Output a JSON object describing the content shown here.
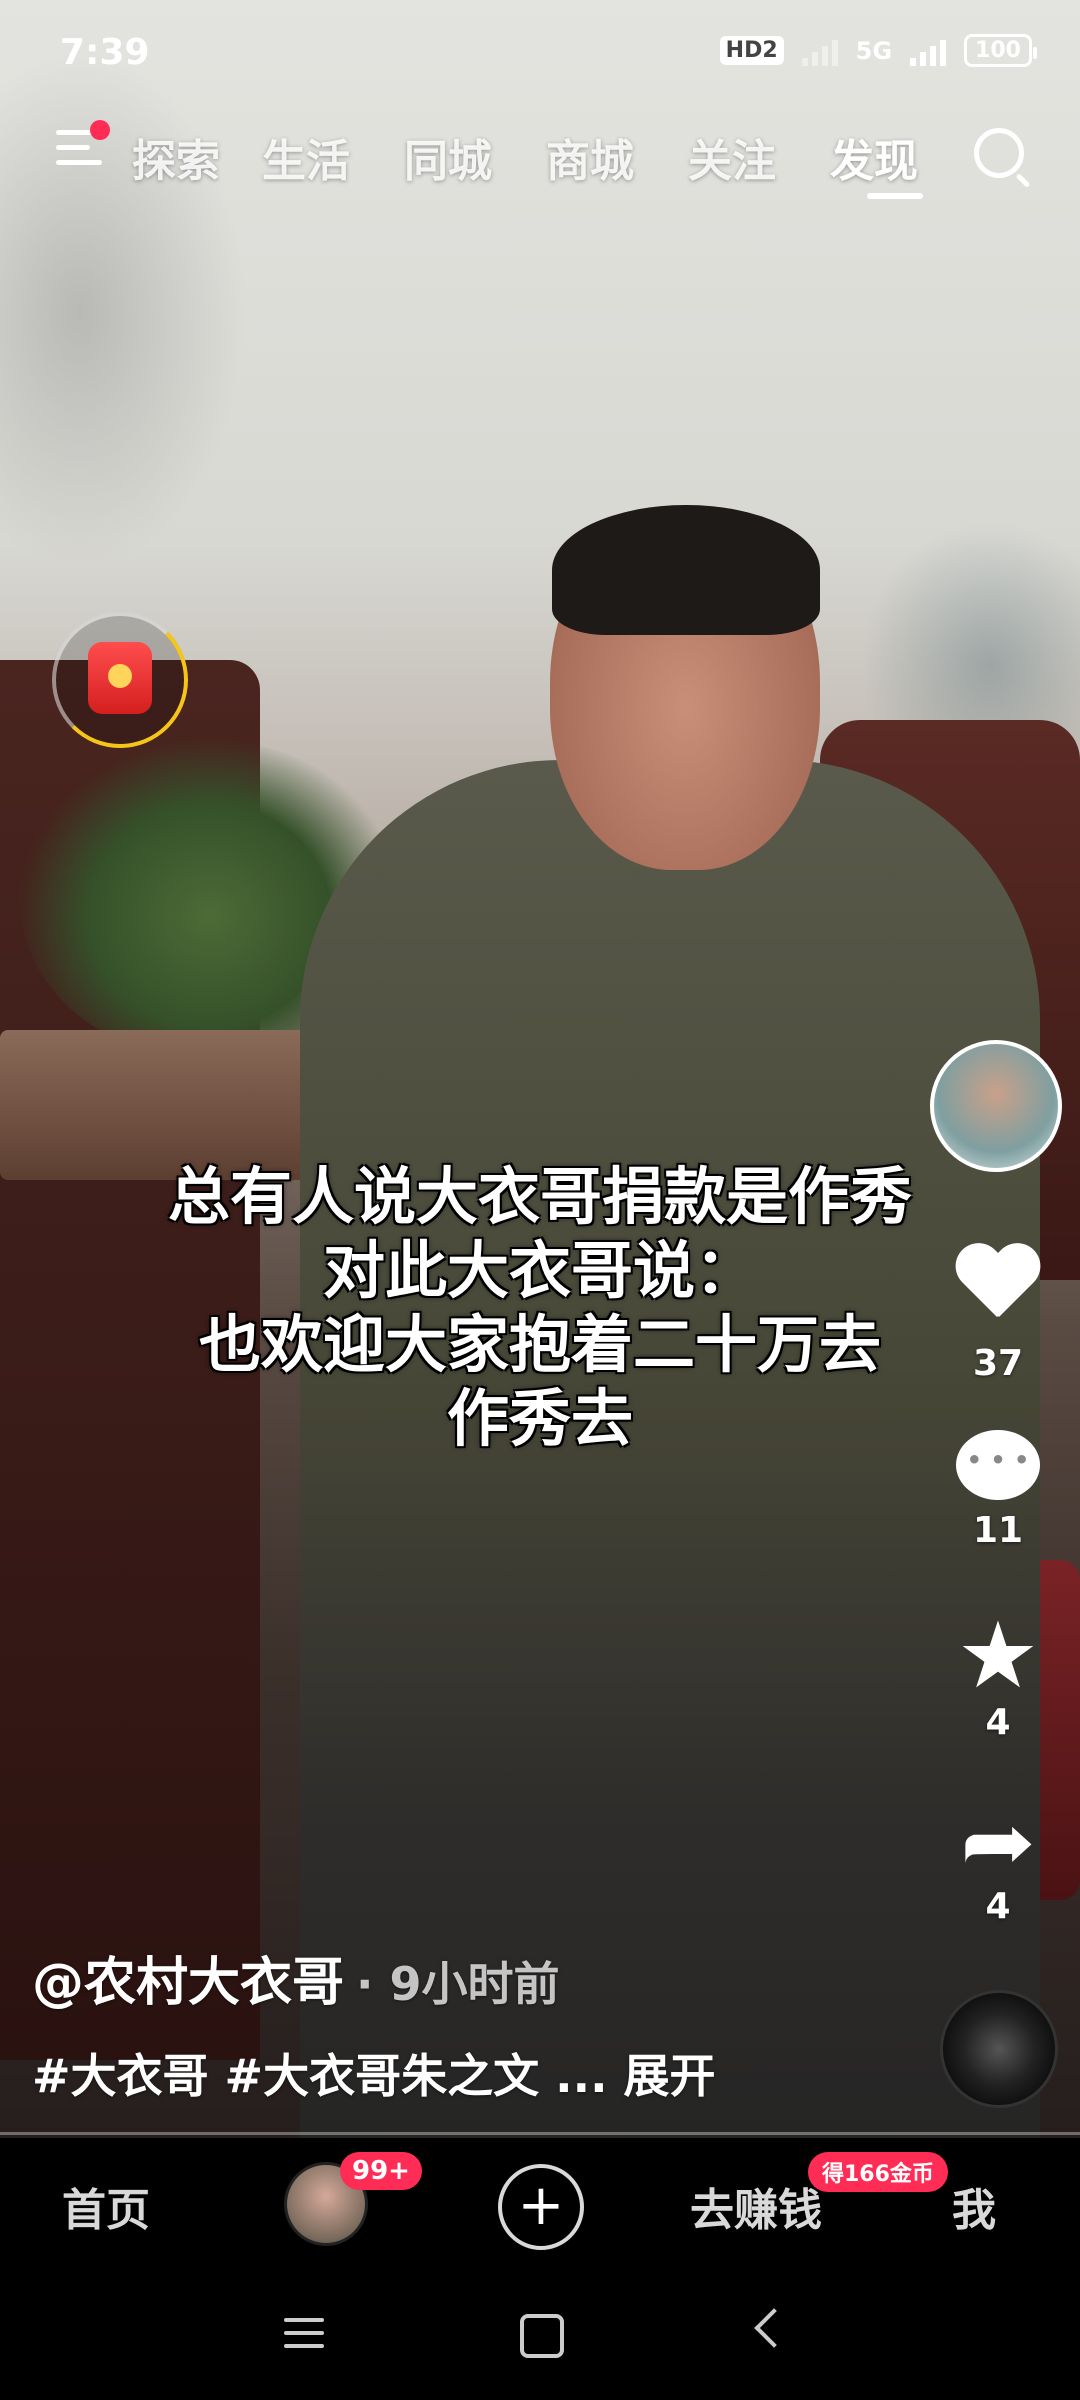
{
  "status_bar": {
    "time": "7:39",
    "hd_label": "HD2",
    "network_label": "5G",
    "battery": "100"
  },
  "top_nav": {
    "tabs": [
      {
        "label": "探索"
      },
      {
        "label": "生活"
      },
      {
        "label": "同城"
      },
      {
        "label": "商城"
      },
      {
        "label": "关注"
      },
      {
        "label": "发现",
        "active": true
      }
    ],
    "has_notification_dot": true
  },
  "caption": {
    "lines": [
      "总有人说大衣哥捐款是作秀",
      "对此大衣哥说：",
      "也欢迎大家抱着二十万去",
      "作秀去"
    ]
  },
  "side_actions": {
    "likes": "37",
    "comments": "11",
    "favorites": "4",
    "shares": "4"
  },
  "post": {
    "author": "@农村大衣哥",
    "time_ago": "9小时前",
    "tags": "#大衣哥 #大衣哥朱之文 ... 展开"
  },
  "bottom_nav": {
    "home": "首页",
    "friends_badge": "99+",
    "earn": "去赚钱",
    "earn_badge": "得166金币",
    "me": "我"
  },
  "colors": {
    "accent": "#ff2d55",
    "ring": "#f5c518",
    "text": "#ffffff"
  }
}
